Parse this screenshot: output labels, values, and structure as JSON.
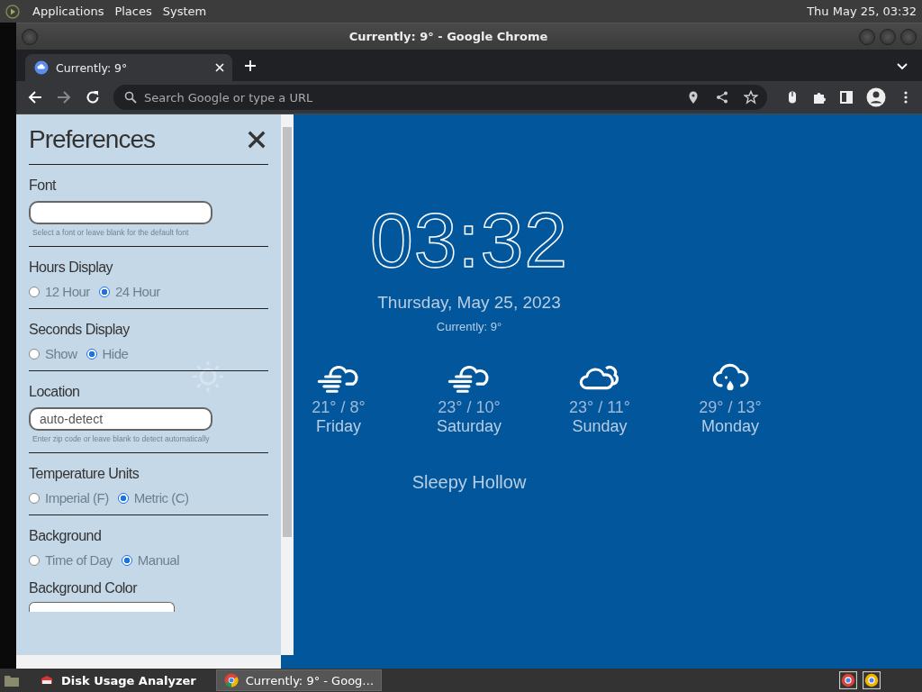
{
  "top_panel": {
    "menus": [
      "Applications",
      "Places",
      "System"
    ],
    "clock": "Thu May 25, 03:32"
  },
  "window": {
    "title": "Currently: 9° - Google Chrome"
  },
  "tabs": [
    {
      "label": "Currently: 9°",
      "selected": true
    }
  ],
  "address_bar": {
    "placeholder": "Search Google or type a URL"
  },
  "preferences": {
    "title": "Preferences",
    "sections": [
      {
        "kind": "text",
        "label": "Font",
        "help": "Select a font or leave blank for the default font"
      },
      {
        "kind": "radio",
        "label": "Hours Display",
        "options": [
          {
            "label": "12 Hour",
            "selected": false
          },
          {
            "label": "24 Hour",
            "selected": true
          }
        ]
      },
      {
        "kind": "radio",
        "label": "Seconds Display",
        "options": [
          {
            "label": "Show",
            "selected": false
          },
          {
            "label": "Hide",
            "selected": true
          }
        ]
      },
      {
        "kind": "text",
        "label": "Location",
        "placeholder": "auto-detect",
        "help": "Enter zip code or leave blank to detect automatically"
      },
      {
        "kind": "radio",
        "label": "Temperature Units",
        "options": [
          {
            "label": "Imperial (F)",
            "selected": false
          },
          {
            "label": "Metric (C)",
            "selected": true
          }
        ]
      },
      {
        "kind": "radio",
        "label": "Background",
        "options": [
          {
            "label": "Time of Day",
            "selected": false
          },
          {
            "label": "Manual",
            "selected": true
          }
        ]
      },
      {
        "kind": "color",
        "label": "Background Color"
      }
    ]
  },
  "weather": {
    "time": "03:32",
    "date": "Thursday, May 25, 2023",
    "current": "Currently: 9°",
    "location": "Sleepy Hollow",
    "forecast": [
      {
        "kind": "sun"
      },
      {
        "kind": "fog",
        "temps": "21° / 8°",
        "day": "Friday"
      },
      {
        "kind": "fog",
        "temps": "23° / 10°",
        "day": "Saturday"
      },
      {
        "kind": "clouds",
        "temps": "23° / 11°",
        "day": "Sunday"
      },
      {
        "kind": "rain",
        "temps": "29° / 13°",
        "day": "Monday"
      }
    ]
  },
  "taskbar": {
    "items": [
      {
        "label": "Disk Usage Analyzer",
        "kind": "disk",
        "selected": false
      },
      {
        "label": "Currently: 9° - Goog…",
        "kind": "chrome",
        "selected": true
      }
    ]
  }
}
